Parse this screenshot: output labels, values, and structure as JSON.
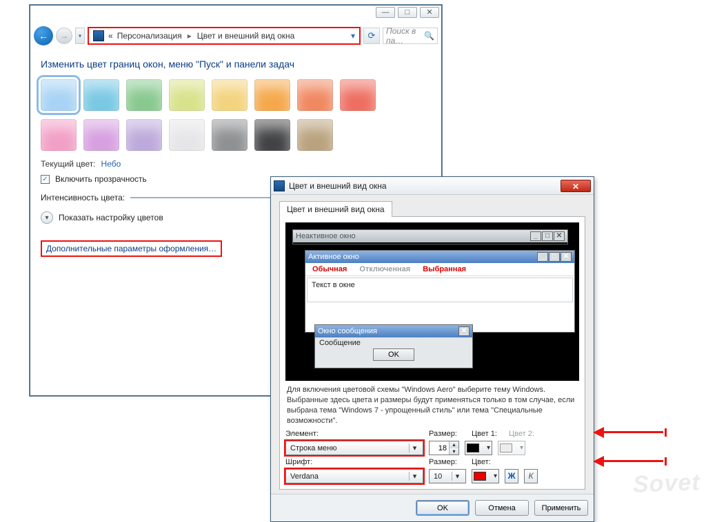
{
  "win_controls": {
    "min": "—",
    "max": "□",
    "close": "✕"
  },
  "breadcrumb": {
    "back_chevrons": "«",
    "level1": "Персонализация",
    "level2": "Цвет и внешний вид окна"
  },
  "search": {
    "placeholder": "Поиск в па…"
  },
  "page": {
    "headline": "Изменить цвет границ окон, меню \"Пуск\" и панели задач",
    "swatches_row1": [
      "#a7d3f5",
      "#79c8e4",
      "#88c98f",
      "#d8e28a",
      "#f3d37d",
      "#f5a84a",
      "#f08860",
      "#ee6e61"
    ],
    "swatches_row2": [
      "#f29fc6",
      "#d7a0e0",
      "#bda9db",
      "#e6e6e8",
      "#8e9092",
      "#424345",
      "#b9a27e"
    ],
    "current_color_label": "Текущий цвет:",
    "current_color_value": "Небо",
    "transparency_label": "Включить прозрачность",
    "intensity_label": "Интенсивность цвета:",
    "show_mixer_label": "Показать настройку цветов",
    "advanced_link": "Дополнительные параметры оформления…"
  },
  "dialog": {
    "title": "Цвет и внешний вид окна",
    "tab": "Цвет и внешний вид окна",
    "preview": {
      "inactive_title": "Неактивное окно",
      "active_title": "Активное окно",
      "menu_normal": "Обычная",
      "menu_disabled": "Отключенная",
      "menu_selected": "Выбранная",
      "text_in_window": "Текст в окне",
      "msg_title": "Окно сообщения",
      "msg_body": "Сообщение",
      "msg_ok": "OK"
    },
    "hint": "Для включения цветовой схемы \"Windows Aero\" выберите тему Windows. Выбранные здесь цвета и размеры будут применяться только в том случае, если выбрана тема \"Windows 7 - упрощенный стиль\" или тема \"Специальные возможности\".",
    "labels": {
      "element": "Элемент:",
      "size": "Размер:",
      "color1": "Цвет 1:",
      "color2": "Цвет 2:",
      "font": "Шрифт:",
      "color": "Цвет:"
    },
    "values": {
      "element": "Строка меню",
      "element_size": "18",
      "color1": "#000000",
      "font": "Verdana",
      "font_size": "10",
      "font_color": "#e60000"
    },
    "bold": "Ж",
    "italic": "К",
    "buttons": {
      "ok": "OK",
      "cancel": "Отмена",
      "apply": "Применить"
    }
  },
  "watermark": "Sovet"
}
